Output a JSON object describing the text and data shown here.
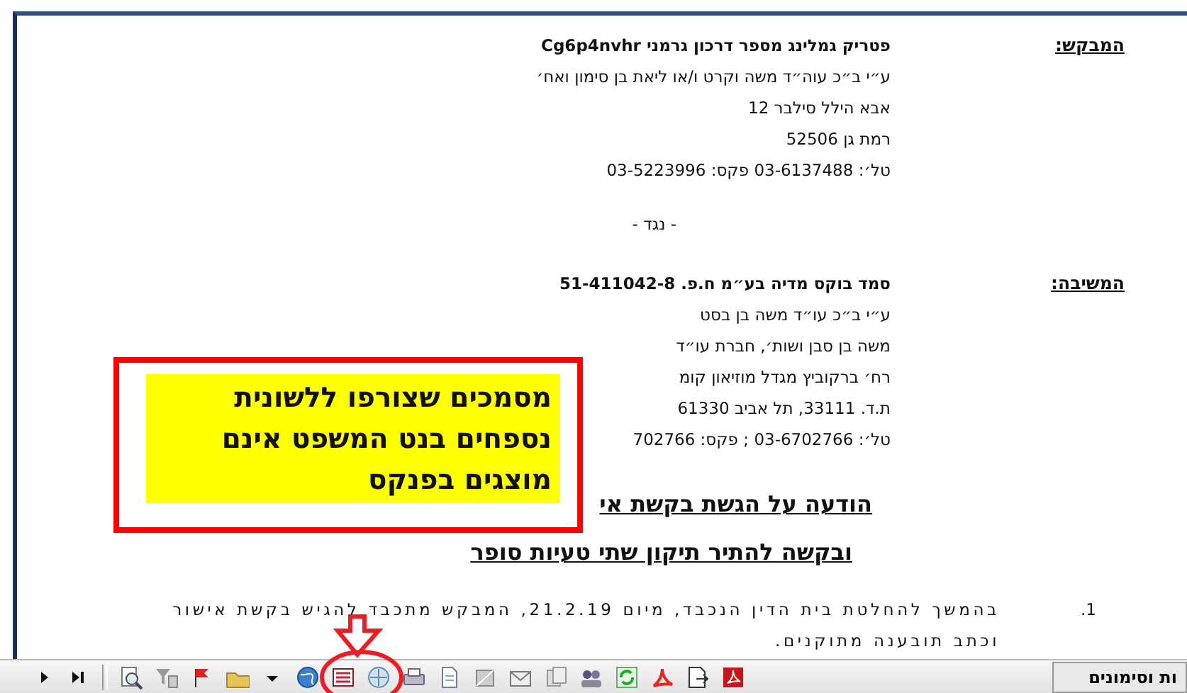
{
  "document": {
    "parties": [
      {
        "label": "המבקש:",
        "lines": [
          {
            "text": "פטריק גמלינג מספר דרכון גרמני Cg6p4nvhr",
            "bold": true
          },
          {
            "text": "ע״י ב״כ עוה״ד משה וקרט ו/או ליאת בן סימון ואח׳",
            "bold": false
          },
          {
            "text": "אבא הילל סילבר 12",
            "bold": false
          },
          {
            "text": "רמת גן 52506",
            "bold": false
          },
          {
            "text": "טל׳: 03-6137488 פקס: 03-5223996",
            "bold": false
          }
        ]
      },
      {
        "label": "המשיבה:",
        "lines": [
          {
            "text": "סמד בוקס מדיה בע״מ ח.פ. 51-411042-8",
            "bold": true
          },
          {
            "text": "ע״י ב״כ עו״ד משה בן בסט",
            "bold": false
          },
          {
            "text": "משה בן סבן ושות׳, חברת עו״ד",
            "bold": false
          },
          {
            "text": "רח׳  ברקוביץ מגדל מוזיאון קומ",
            "bold": false
          },
          {
            "text": "ת.ד. 33111, תל אביב 61330",
            "bold": false
          },
          {
            "text": "טל׳: 03-6702766 ; פקס: 702766",
            "bold": false
          }
        ]
      }
    ],
    "versus": "- נגד -",
    "headings": [
      "הודעה על הגשת בקשת אי",
      "ובקשה להתיר תיקון שתי טעיות סופר"
    ],
    "paragraphs": [
      {
        "number": "1.",
        "lines": [
          "בהמשך להחלטת בית הדין הנכבד, מיום 21.2.19, המבקש מתכבד להגיש בקשת אישור",
          "וכתב תובענה מתוקנים."
        ]
      }
    ]
  },
  "callout": {
    "lines": [
      "מסמכים שצורפו ללשונית",
      "נספחים בנט המשפט אינם",
      "מוצגים בפנקס"
    ]
  },
  "side_tab": {
    "label": "ות וסימונים"
  }
}
